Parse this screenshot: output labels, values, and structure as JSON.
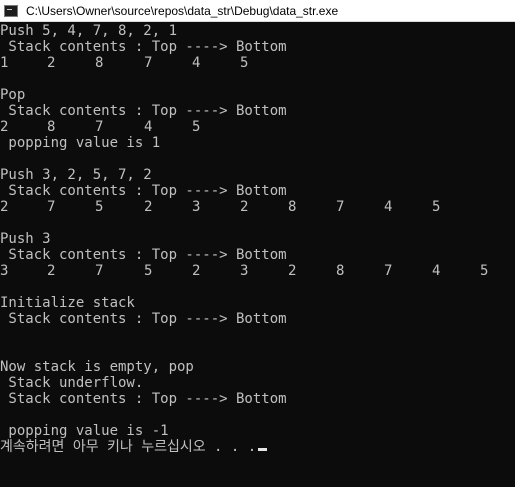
{
  "window": {
    "title": "C:\\Users\\Owner\\source\\repos\\data_str\\Debug\\data_str.exe",
    "icon": "console-app-icon"
  },
  "console": {
    "push1": "Push 5, 4, 7, 8, 2, 1",
    "contents_label": " Stack contents : Top ----> Bottom",
    "stack1": [
      "1",
      "2",
      "8",
      "7",
      "4",
      "5"
    ],
    "pop_cmd": "Pop",
    "stack2": [
      "2",
      "8",
      "7",
      "4",
      "5"
    ],
    "popping1": " popping value is 1",
    "push2": "Push 3, 2, 5, 7, 2",
    "stack3": [
      "2",
      "7",
      "5",
      "2",
      "3",
      "2",
      "8",
      "7",
      "4",
      "5"
    ],
    "push3": "Push 3",
    "stack4": [
      "3",
      "2",
      "7",
      "5",
      "2",
      "3",
      "2",
      "8",
      "7",
      "4",
      "5"
    ],
    "init": "Initialize stack",
    "empty_pop": "Now stack is empty, pop",
    "underflow": " Stack underflow.",
    "popping2": " popping value is -1",
    "prompt": "계속하려면 아무 키나 누르십시오 . . ."
  }
}
